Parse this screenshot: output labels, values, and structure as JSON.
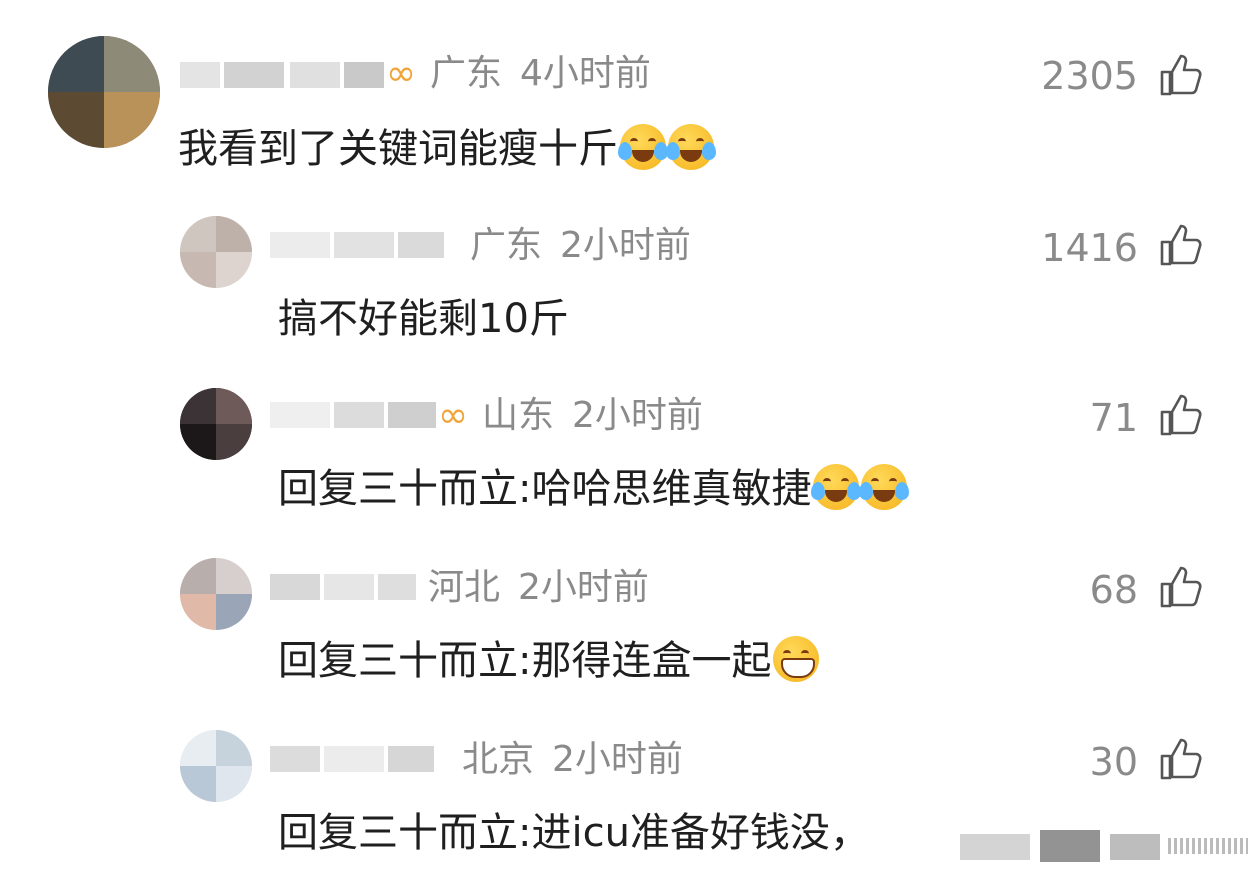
{
  "comments": [
    {
      "location": "广东",
      "time": "4小时前",
      "likes": "2305",
      "text": "我看到了关键词能瘦十斤",
      "badge": "∞",
      "emoji": [
        "laugh-cry",
        "laugh-cry"
      ]
    },
    {
      "location": "广东",
      "time": "2小时前",
      "likes": "1416",
      "text": "搞不好能剩10斤",
      "emoji": []
    },
    {
      "location": "山东",
      "time": "2小时前",
      "likes": "71",
      "text": "回复三十而立:哈哈思维真敏捷",
      "badge": "∞",
      "emoji": [
        "laugh-cry",
        "laugh-cry"
      ]
    },
    {
      "location": "河北",
      "time": "2小时前",
      "likes": "68",
      "text": "回复三十而立:那得连盒一起",
      "emoji": [
        "grin"
      ]
    },
    {
      "location": "北京",
      "time": "2小时前",
      "likes": "30",
      "text": "回复三十而立:进icu准备好钱没，",
      "emoji": []
    }
  ],
  "icons": {
    "like": "thumbs-up-icon"
  },
  "colors": {
    "meta": "#8a8a8a",
    "badge": "#f0a53a",
    "text": "#1f1f1f"
  }
}
